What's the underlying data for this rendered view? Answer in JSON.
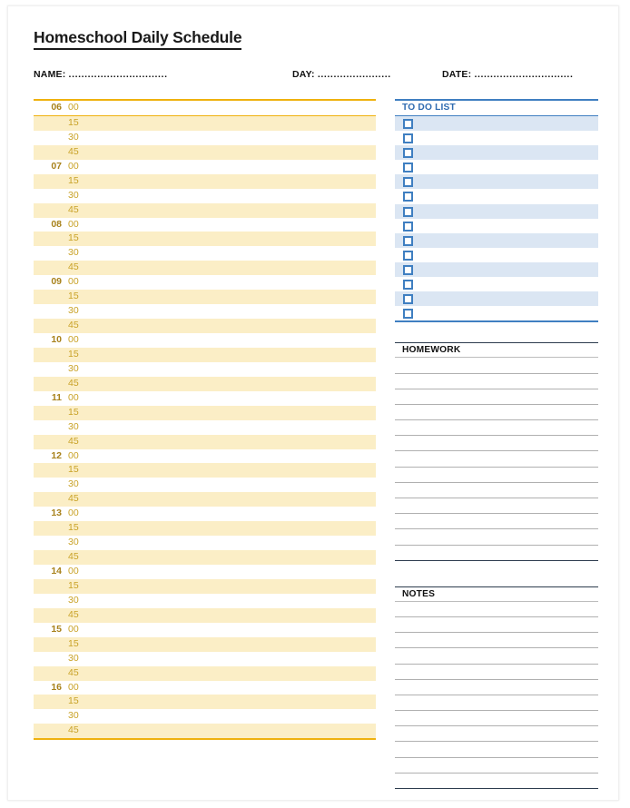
{
  "document": {
    "title": "Homeschool Daily Schedule"
  },
  "meta": {
    "name_label": "NAME:",
    "name_value": "...............................",
    "day_label": "DAY:",
    "day_value": ".......................",
    "date_label": "DATE:",
    "date_value": "..............................."
  },
  "schedule": {
    "hours": [
      "06",
      "07",
      "08",
      "09",
      "10",
      "11",
      "12",
      "13",
      "14",
      "15",
      "16"
    ],
    "minutes": [
      "00",
      "15",
      "30",
      "45"
    ],
    "accent_color": "#efb10e",
    "row_shade_color": "#fbeec6",
    "hour_text_color": "#a8821c",
    "minute_text_color": "#c9a227"
  },
  "todo": {
    "title": "TO DO LIST",
    "item_count": 14,
    "accent_color": "#3f7fc1",
    "row_shade_color": "#dbe6f3",
    "checkbox_icon": "empty-checkbox"
  },
  "homework": {
    "title": "HOMEWORK",
    "line_count": 13,
    "rule_color": "#b0b0b0",
    "border_color": "#2d3c4e"
  },
  "notes": {
    "title": "NOTES",
    "line_count": 12,
    "rule_color": "#b0b0b0",
    "border_color": "#2d3c4e"
  }
}
